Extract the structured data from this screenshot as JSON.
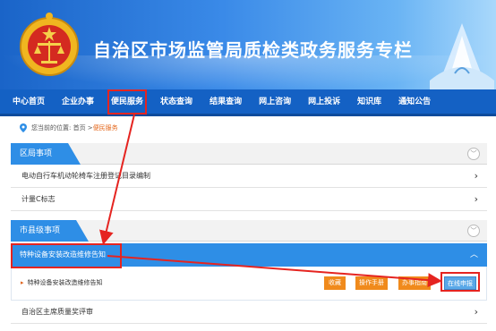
{
  "header": {
    "title": "自治区市场监管局质检类政务服务专栏"
  },
  "nav": {
    "items": [
      {
        "label": "中心首页"
      },
      {
        "label": "企业办事"
      },
      {
        "label": "便民服务"
      },
      {
        "label": "状态查询"
      },
      {
        "label": "结果查询"
      },
      {
        "label": "网上咨询"
      },
      {
        "label": "网上投诉"
      },
      {
        "label": "知识库"
      },
      {
        "label": "通知公告"
      }
    ]
  },
  "breadcrumb": {
    "prefix": "您当前的位置: 首页 > ",
    "current": "便民服务"
  },
  "sections": {
    "district": {
      "title": "区局事项"
    },
    "county": {
      "title": "市县级事项"
    }
  },
  "rows": {
    "ev": "电动自行车机动轮椅车注册登记目录编制",
    "metrology": "计量C标志",
    "quality_award": "自治区主席质量奖评审"
  },
  "expanded": {
    "title": "特种设备安装改造维修告知",
    "item": "特种设备安装改造维修告知",
    "buttons": {
      "favorite": "收藏",
      "manual": "操作手册",
      "guide": "办事指南",
      "apply": "在线申报"
    }
  },
  "colors": {
    "nav_bg": "#1461c4",
    "accent": "#2e8ee6",
    "highlight": "#e52420",
    "button_orange": "#f08a1c"
  }
}
